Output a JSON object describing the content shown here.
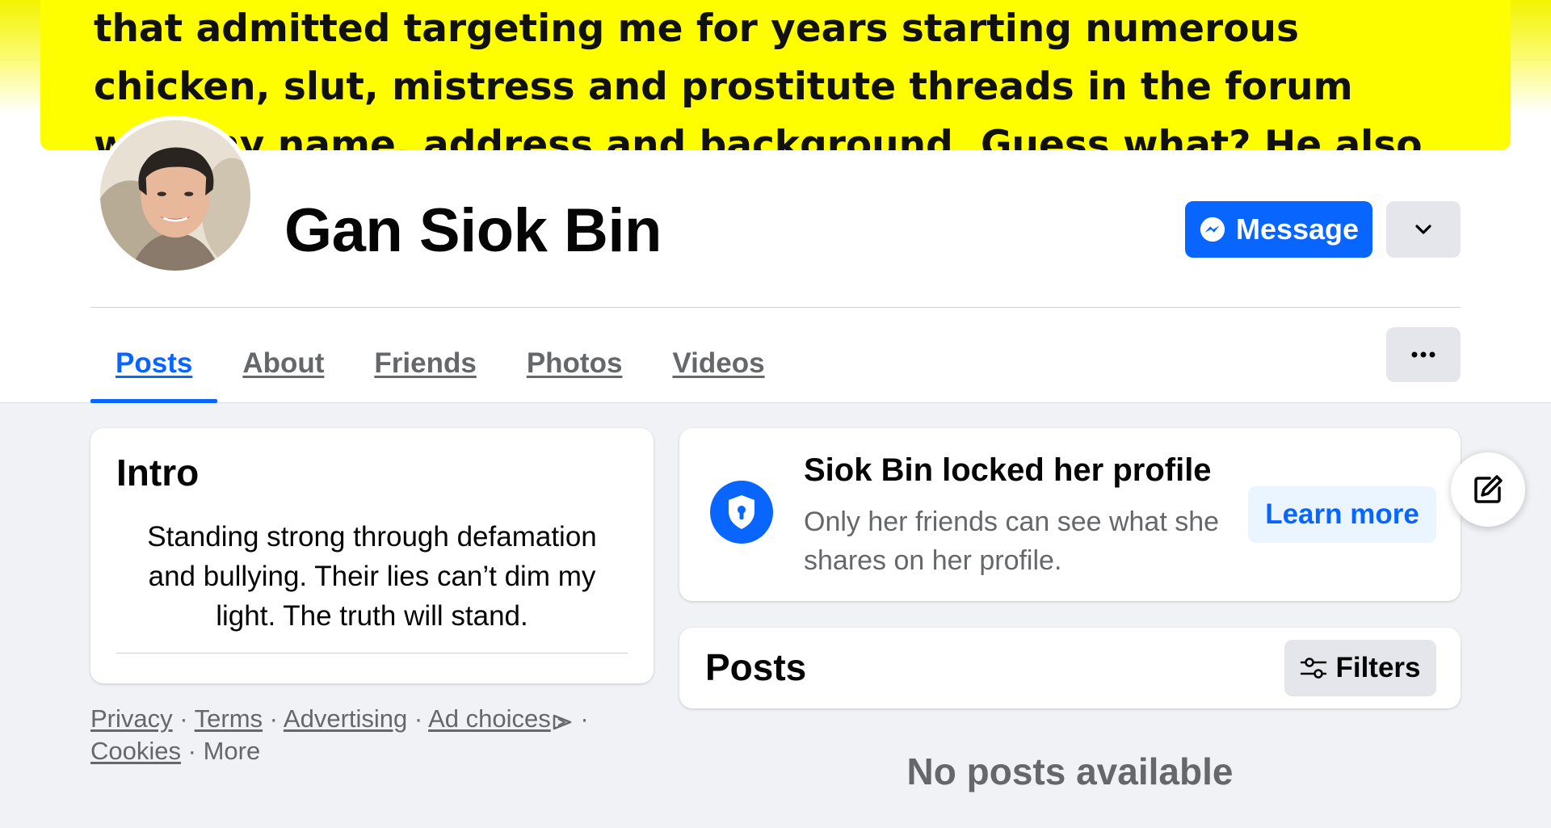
{
  "cover": {
    "lines": [
      "that admitted targeting me for years starting numerous",
      "chicken, slut, mistress and prostitute threads in the forum",
      "with my name, address and background. Guess what? He also"
    ]
  },
  "profile": {
    "name": "Gan Siok Bin"
  },
  "actions": {
    "message_label": "Message"
  },
  "tabs": [
    {
      "label": "Posts",
      "active": true
    },
    {
      "label": "About",
      "active": false
    },
    {
      "label": "Friends",
      "active": false
    },
    {
      "label": "Photos",
      "active": false
    },
    {
      "label": "Videos",
      "active": false
    }
  ],
  "intro": {
    "title": "Intro",
    "bio": "Standing strong through defamation and bullying. Their lies can’t dim my light. The truth will stand."
  },
  "footer": {
    "privacy": "Privacy",
    "terms": "Terms",
    "advertising": "Advertising",
    "ad_choices": "Ad choices",
    "cookies": "Cookies",
    "more": "More",
    "separator": "·"
  },
  "locked": {
    "title": "Siok Bin locked her profile",
    "text": "Only her friends can see what she shares on her profile.",
    "learn_more": "Learn more"
  },
  "posts": {
    "title": "Posts",
    "filters_label": "Filters",
    "empty_text": "No posts available"
  },
  "colors": {
    "accent": "#0866ff",
    "cover_bg": "#fefe00",
    "page_bg": "#f0f2f5"
  },
  "icons": {
    "message": "messenger-icon",
    "dropdown": "chevron-down-icon",
    "more": "more-dots-icon",
    "lock": "shield-lock-icon",
    "edit": "edit-icon",
    "filters": "filters-icon",
    "ad_choices": "ad-choices-icon"
  }
}
